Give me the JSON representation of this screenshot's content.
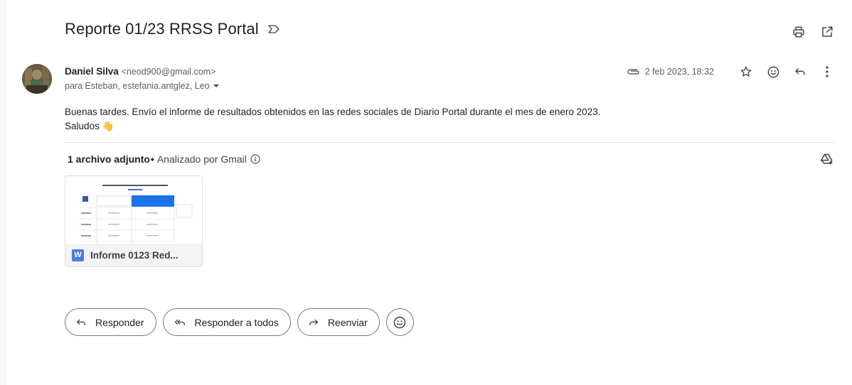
{
  "email": {
    "subject": "Reporte 01/23 RRSS Portal",
    "sender_name": "Daniel Silva",
    "sender_email": "<neod900@gmail.com>",
    "recipients": "para Esteban, estefania.antglez, Leo",
    "date": "2 feb 2023, 18:32",
    "body_line1": "Buenas tardes. Envío el informe de resultados obtenidos en las redes sociales de Diario Portal durante el mes de enero 2023.",
    "body_line2": "Saludos 👋"
  },
  "attachments": {
    "count_label": "1 archivo adjunto",
    "separator": "•",
    "scan_label": "Analizado por Gmail",
    "file": {
      "name": "Informe 0123 Red...",
      "type_badge": "W"
    }
  },
  "actions": {
    "reply": "Responder",
    "reply_all": "Responder a todos",
    "forward": "Reenviar"
  },
  "icons": {
    "label": "label-outline-icon",
    "print": "print-icon",
    "open_new_window": "open-in-new-icon",
    "attachment": "paperclip-icon",
    "star": "star-outline-icon",
    "emoji": "emoji-icon",
    "reply": "reply-icon",
    "more": "more-vert-icon",
    "drive": "add-to-drive-icon",
    "info": "info-icon"
  },
  "colors": {
    "word_blue": "#4a7ce0",
    "accent_blue": "#1a73e8"
  }
}
